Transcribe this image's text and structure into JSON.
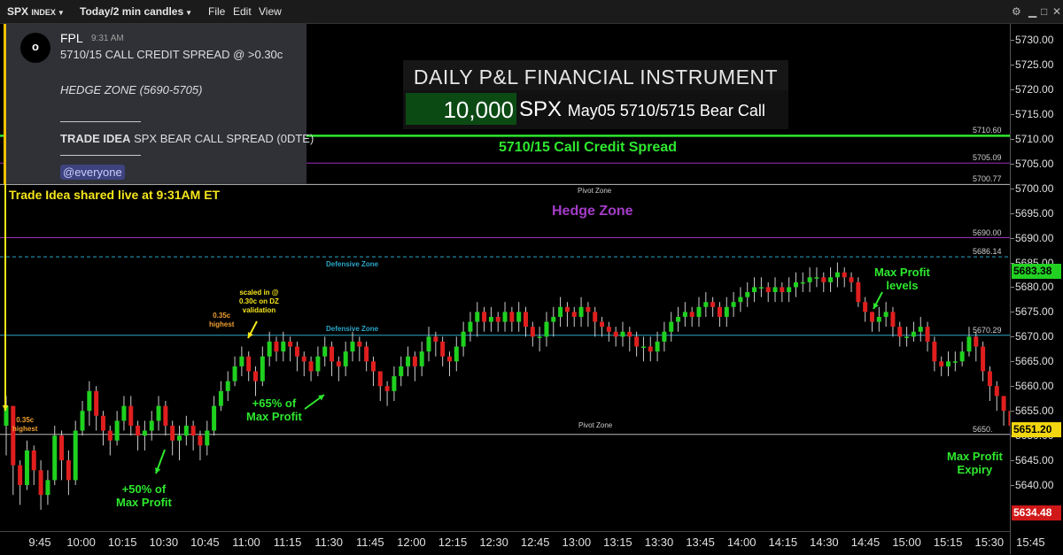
{
  "toolbar": {
    "symbol": "SPX",
    "symbol_suffix": "INDEX",
    "timeframe": "Today/2 min candles",
    "menu": [
      "File",
      "Edit",
      "View"
    ]
  },
  "message": {
    "avatar_glyph": "o",
    "author": "FPL",
    "time": "9:31 AM",
    "line1": "5710/15 CALL CREDIT SPREAD @ >0.30c",
    "line2": "HEDGE ZONE (5690-5705)",
    "sep1": "———————",
    "line3_bold": "TRADE IDEA",
    "line3_rest": " SPX BEAR CALL SPREAD (0DTE)",
    "sep2": "———————",
    "mention": "@everyone"
  },
  "pl_panel": {
    "title": "DAILY P&L FINANCIAL INSTRUMENT",
    "quantity": "10,000",
    "symbol": "SPX",
    "contract": "May05 5710/5715 Bear Call"
  },
  "annotations": {
    "trade_idea": "Trade Idea shared live at 9:31AM ET",
    "credit_spread": "5710/15 Call Credit Spread",
    "hedge_zone": "Hedge Zone",
    "pivot_zone_top": "Pivot Zone",
    "pivot_zone_bottom": "Pivot Zone",
    "defensive_zone_top": "Defensive Zone",
    "defensive_zone_mid": "Defensive Zone",
    "highest_1_a": "0.35c",
    "highest_1_b": "highest",
    "highest_2_a": "0.35c",
    "highest_2_b": "highest",
    "scaled_1": "scaled in @",
    "scaled_2": "0.30c on DZ",
    "scaled_3": "validation",
    "profit65_1": "+65% of",
    "profit65_2": "Max Profit",
    "profit50_1": "+50% of",
    "profit50_2": "Max Profit",
    "maxprofit_levels_1": "Max Profit",
    "maxprofit_levels_2": "levels",
    "maxprofit_expiry_1": "Max Profit",
    "maxprofit_expiry_2": "Expiry"
  },
  "levels": [
    {
      "id": "credit",
      "price": 5710.6,
      "label": "5710.60",
      "color": "#2ee82e"
    },
    {
      "id": "hedge-top",
      "price": 5705.09,
      "label": "5705.09",
      "color": "#9b30b8"
    },
    {
      "id": "pivot-top",
      "price": 5700.77,
      "label": "5700.77",
      "color": "#bbbbbb"
    },
    {
      "id": "hedge-bottom",
      "price": 5690.0,
      "label": "5690.00",
      "color": "#9b30b8"
    },
    {
      "id": "defensive-top",
      "price": 5686.14,
      "label": "5686.14",
      "color": "#2aa8c8"
    },
    {
      "id": "defensive-mid",
      "price": 5670.29,
      "label": "5670.29",
      "color": "#2aa8c8"
    },
    {
      "id": "pivot-bottom",
      "price": 5650.25,
      "label": "5650.",
      "color": "#bbbbbb"
    }
  ],
  "price_axis": {
    "ticks": [
      "5730.00",
      "5725.00",
      "5720.00",
      "5715.00",
      "5710.00",
      "5705.00",
      "5700.00",
      "5695.00",
      "5690.00",
      "5685.00",
      "5680.00",
      "5675.00",
      "5670.00",
      "5665.00",
      "5660.00",
      "5655.00",
      "5650.00",
      "5645.00",
      "5640.00"
    ],
    "last_price": "5651.20",
    "high_tag": "5683.38",
    "low_tag": "5634.48",
    "last_color": "#f2d60f",
    "high_color": "#22d022",
    "low_color": "#d01818"
  },
  "time_axis": {
    "ticks": [
      "9:45",
      "10:00",
      "10:15",
      "10:30",
      "10:45",
      "11:00",
      "11:15",
      "11:30",
      "11:45",
      "12:00",
      "12:15",
      "12:30",
      "12:45",
      "13:00",
      "13:15",
      "13:30",
      "13:45",
      "14:00",
      "14:15",
      "14:30",
      "14:45",
      "15:00",
      "15:15",
      "15:30",
      "15:45"
    ]
  },
  "colors": {
    "up": "#1fd11f",
    "down": "#e01e1e",
    "annot_green": "#2ee82e",
    "annot_yellow": "#f5e61a",
    "annot_orange": "#f0a030",
    "annot_purple": "#a43cc8",
    "annot_cyan": "#2aa8c8"
  },
  "chart_data": {
    "type": "candlestick",
    "title": "",
    "xlabel": "",
    "ylabel": "",
    "ylim": [
      5632,
      5733
    ],
    "x_start": "9:30",
    "interval_minutes": 2,
    "closes": [
      5656,
      5644,
      5640,
      5647,
      5643,
      5638,
      5641,
      5650,
      5645,
      5641,
      5651,
      5655,
      5659,
      5654,
      5651,
      5649,
      5653,
      5656,
      5652,
      5650,
      5651,
      5653,
      5656,
      5652,
      5649,
      5650,
      5652,
      5650,
      5648,
      5651,
      5656,
      5659,
      5661,
      5664,
      5666,
      5663,
      5661,
      5666,
      5669,
      5667,
      5669,
      5668,
      5666,
      5665,
      5663,
      5666,
      5668,
      5665,
      5664,
      5667,
      5669,
      5668,
      5665,
      5663,
      5660,
      5659,
      5662,
      5664,
      5666,
      5664,
      5667,
      5670,
      5669,
      5666,
      5665,
      5668,
      5671,
      5673,
      5675,
      5673,
      5674,
      5673,
      5675,
      5673,
      5675,
      5672,
      5670,
      5670,
      5673,
      5674,
      5676,
      5675,
      5674,
      5676,
      5675,
      5673,
      5672,
      5671,
      5670,
      5671,
      5670,
      5668,
      5668,
      5667,
      5669,
      5671,
      5673,
      5674,
      5675,
      5674,
      5676,
      5677,
      5676,
      5674,
      5676,
      5677,
      5678,
      5679,
      5680,
      5680,
      5679,
      5680,
      5679,
      5680,
      5681,
      5681,
      5682,
      5682,
      5681,
      5682,
      5683,
      5682,
      5681,
      5677,
      5675,
      5673,
      5674,
      5675,
      5672,
      5670,
      5670,
      5671,
      5672,
      5669,
      5665,
      5664,
      5665,
      5665,
      5667,
      5670,
      5668,
      5663,
      5660,
      5658,
      5655,
      5652,
      5649,
      5651
    ],
    "highs": [
      5658,
      5656,
      5645,
      5649,
      5648,
      5645,
      5643,
      5652,
      5651,
      5647,
      5653,
      5657,
      5661,
      5660,
      5655,
      5652,
      5655,
      5658,
      5658,
      5653,
      5653,
      5655,
      5658,
      5657,
      5653,
      5652,
      5654,
      5653,
      5651,
      5653,
      5658,
      5661,
      5663,
      5666,
      5668,
      5667,
      5664,
      5668,
      5671,
      5670,
      5671,
      5670,
      5669,
      5667,
      5666,
      5668,
      5670,
      5669,
      5666,
      5669,
      5671,
      5670,
      5669,
      5666,
      5663,
      5661,
      5664,
      5666,
      5668,
      5667,
      5669,
      5672,
      5671,
      5670,
      5667,
      5670,
      5673,
      5675,
      5677,
      5676,
      5676,
      5675,
      5677,
      5676,
      5677,
      5676,
      5673,
      5672,
      5675,
      5676,
      5678,
      5677,
      5676,
      5678,
      5677,
      5676,
      5674,
      5673,
      5672,
      5673,
      5672,
      5671,
      5670,
      5670,
      5671,
      5673,
      5675,
      5676,
      5677,
      5676,
      5678,
      5679,
      5678,
      5677,
      5678,
      5679,
      5680,
      5681,
      5682,
      5682,
      5681,
      5682,
      5681,
      5682,
      5683,
      5683,
      5684,
      5684,
      5683,
      5684,
      5685,
      5684,
      5683,
      5682,
      5678,
      5675,
      5676,
      5677,
      5676,
      5673,
      5672,
      5673,
      5674,
      5673,
      5670,
      5666,
      5667,
      5667,
      5669,
      5672,
      5671,
      5669,
      5664,
      5661,
      5658,
      5656,
      5652,
      5653
    ],
    "lows": [
      5646,
      5638,
      5636,
      5639,
      5640,
      5635,
      5636,
      5640,
      5641,
      5638,
      5640,
      5650,
      5652,
      5651,
      5648,
      5646,
      5648,
      5651,
      5650,
      5647,
      5647,
      5649,
      5651,
      5650,
      5646,
      5645,
      5648,
      5647,
      5645,
      5646,
      5650,
      5655,
      5657,
      5660,
      5662,
      5661,
      5658,
      5660,
      5664,
      5665,
      5665,
      5665,
      5663,
      5662,
      5661,
      5662,
      5664,
      5662,
      5661,
      5662,
      5665,
      5665,
      5663,
      5660,
      5657,
      5656,
      5657,
      5660,
      5662,
      5661,
      5662,
      5665,
      5666,
      5664,
      5662,
      5663,
      5666,
      5669,
      5670,
      5671,
      5671,
      5671,
      5671,
      5671,
      5671,
      5670,
      5668,
      5667,
      5668,
      5670,
      5672,
      5672,
      5672,
      5672,
      5672,
      5670,
      5670,
      5669,
      5668,
      5668,
      5667,
      5666,
      5665,
      5665,
      5665,
      5667,
      5669,
      5671,
      5672,
      5672,
      5672,
      5674,
      5674,
      5672,
      5672,
      5674,
      5675,
      5676,
      5677,
      5678,
      5677,
      5677,
      5677,
      5677,
      5678,
      5679,
      5679,
      5680,
      5679,
      5679,
      5680,
      5680,
      5679,
      5676,
      5673,
      5671,
      5671,
      5672,
      5670,
      5668,
      5668,
      5669,
      5669,
      5667,
      5663,
      5662,
      5662,
      5663,
      5664,
      5666,
      5665,
      5661,
      5657,
      5655,
      5652,
      5649,
      5647,
      5648
    ]
  }
}
